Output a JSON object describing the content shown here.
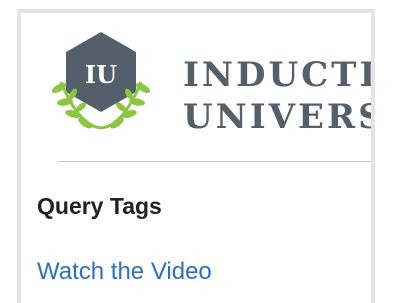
{
  "logo": {
    "monogram": "IU",
    "line1": "INDUCTIVE",
    "line2": "UNIVERSITY",
    "colors": {
      "hexagon": "#53606c",
      "laurel": "#8cc63f",
      "text": "#53606c"
    }
  },
  "section": {
    "title": "Query Tags",
    "link_label": "Watch the Video"
  },
  "colors": {
    "link": "#2f6fc2",
    "panel_border": "#e4e4e4",
    "divider": "#c8c8c8"
  }
}
